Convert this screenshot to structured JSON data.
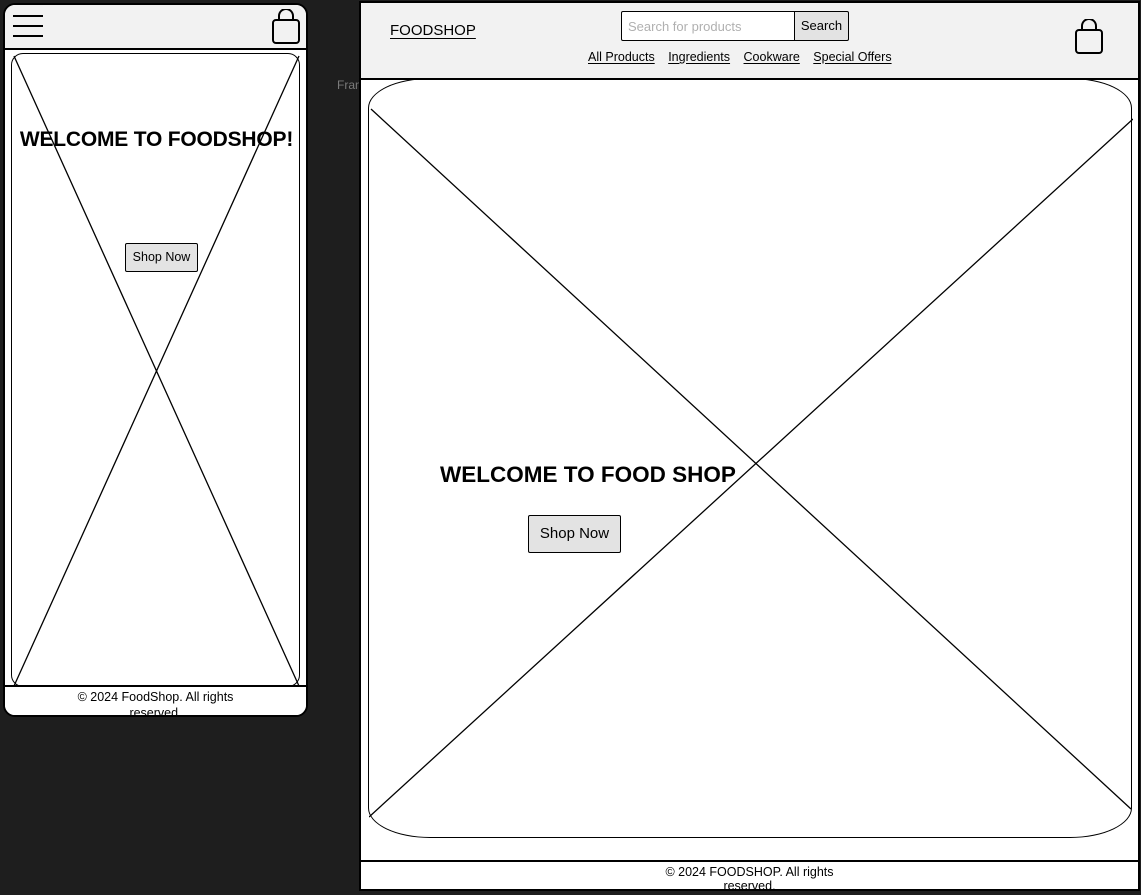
{
  "canvas": {
    "frame_label": "Fram"
  },
  "mobile": {
    "menu_icon": "hamburger-icon",
    "cart_icon": "shopping-bag-icon",
    "hero_title": "WELCOME TO FOODSHOP!",
    "shop_button": "Shop Now",
    "footer_text": "© 2024 FoodShop. All rights reserved."
  },
  "desktop": {
    "logo": "FOODSHOP",
    "search": {
      "placeholder": "Search for products",
      "button_label": "Search"
    },
    "nav": [
      "All Products",
      "Ingredients",
      "Cookware",
      "Special Offers"
    ],
    "cart_icon": "shopping-bag-icon",
    "hero_title": "WELCOME TO FOOD SHOP",
    "shop_button": "Shop Now",
    "footer_text": "© 2024 FOODSHOP. All rights reserved."
  },
  "colors": {
    "canvas_bg": "#1e1e1e",
    "header_bg": "#f2f2f2",
    "button_bg": "#e3e3e3",
    "placeholder": "#b0b0b0"
  }
}
